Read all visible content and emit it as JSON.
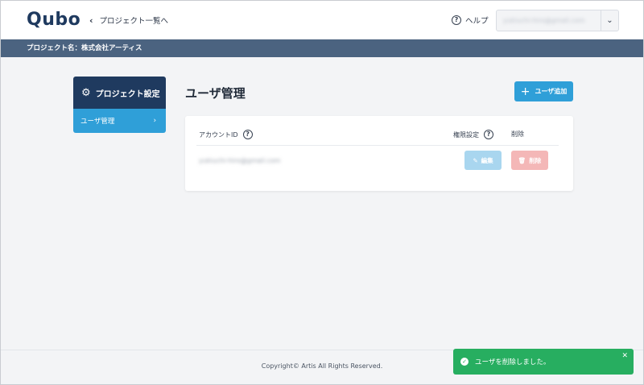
{
  "header": {
    "logo": "Qubo",
    "back_label": "プロジェクト一覧へ",
    "help_label": "ヘルプ",
    "user_email": "yukiuchi-hiro@gmail.com"
  },
  "project_bar": {
    "label": "プロジェクト名：株式会社アーティス"
  },
  "sidebar": {
    "title": "プロジェクト設定",
    "items": [
      {
        "label": "ユーザ管理"
      }
    ]
  },
  "main": {
    "title": "ユーザ管理",
    "add_button": "ユーザ追加",
    "table": {
      "columns": [
        "アカウントID",
        "権限設定",
        "削除"
      ],
      "rows": [
        {
          "account_id": "yukiuchi-hiro@gmail.com",
          "edit_label": "編集",
          "delete_label": "削除"
        }
      ]
    }
  },
  "footer": {
    "copyright": "Copyright© Artis All Rights Reserved."
  },
  "toast": {
    "message": "ユーザを削除しました。"
  },
  "colors": {
    "navy": "#1f3a5f",
    "accent": "#2f9fd8",
    "project_bar": "#4b6380",
    "success": "#27ae60",
    "danger_light": "#f4b7b7"
  }
}
